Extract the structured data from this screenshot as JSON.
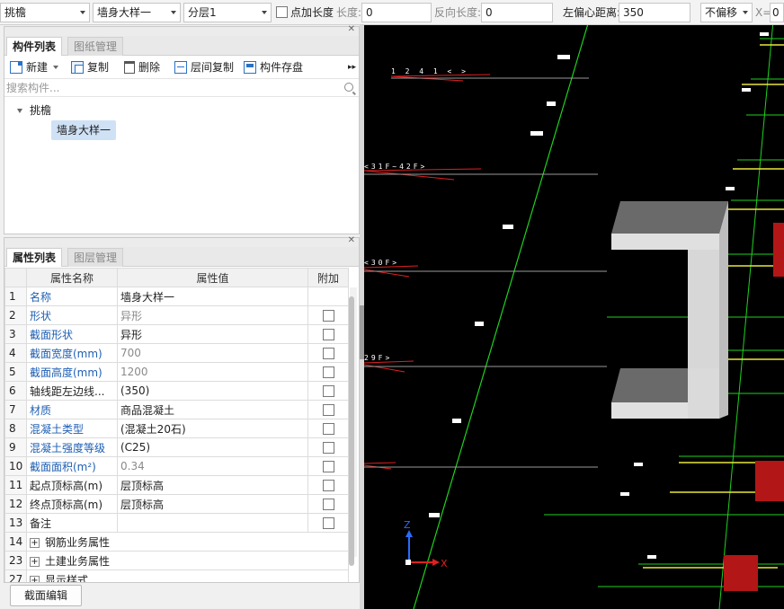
{
  "toolbar": {
    "category": "挑檐",
    "component": "墙身大样一",
    "layer": "分层1",
    "point_length_label": "点加长度",
    "length_label": "长度:",
    "length_value": "0",
    "reverse_length_label": "反向长度:",
    "reverse_length_value": "0",
    "left_offset_label": "左偏心距离:",
    "left_offset_value": "350",
    "offset_mode": "不偏移",
    "x_label": "X=",
    "x_value": "0"
  },
  "component_panel": {
    "tabs": [
      "构件列表",
      "图纸管理"
    ],
    "tools": {
      "new": "新建",
      "copy": "复制",
      "delete": "删除",
      "floor_copy": "层间复制",
      "save": "构件存盘"
    },
    "search_placeholder": "搜索构件...",
    "tree": {
      "root": "挑檐",
      "child": "墙身大样一"
    }
  },
  "property_panel": {
    "tabs": [
      "属性列表",
      "图层管理"
    ],
    "columns": [
      "",
      "属性名称",
      "属性值",
      "附加"
    ],
    "rows": [
      {
        "no": "1",
        "name": "名称",
        "value": "墙身大样一"
      },
      {
        "no": "2",
        "name": "形状",
        "value": "异形"
      },
      {
        "no": "3",
        "name": "截面形状",
        "value": "异形"
      },
      {
        "no": "4",
        "name": "截面宽度(mm)",
        "value": "700"
      },
      {
        "no": "5",
        "name": "截面高度(mm)",
        "value": "1200"
      },
      {
        "no": "6",
        "name": "轴线距左边线...",
        "value": "(350)"
      },
      {
        "no": "7",
        "name": "材质",
        "value": "商品混凝土"
      },
      {
        "no": "8",
        "name": "混凝土类型",
        "value": "(混凝土20石)"
      },
      {
        "no": "9",
        "name": "混凝土强度等级",
        "value": "(C25)"
      },
      {
        "no": "10",
        "name": "截面面积(m²)",
        "value": "0.34"
      },
      {
        "no": "11",
        "name": "起点顶标高(m)",
        "value": "层顶标高"
      },
      {
        "no": "12",
        "name": "终点顶标高(m)",
        "value": "层顶标高"
      },
      {
        "no": "13",
        "name": "备注",
        "value": ""
      },
      {
        "no": "14",
        "name": "钢筋业务属性",
        "value": ""
      },
      {
        "no": "23",
        "name": "土建业务属性",
        "value": ""
      },
      {
        "no": "27",
        "name": "显示样式",
        "value": ""
      }
    ],
    "section_edit_button": "截面编辑"
  },
  "viewport": {
    "axis_labels": {
      "z": "Z",
      "x": "X"
    },
    "colors": {
      "background": "#000000",
      "axis_line": "#1fd11f",
      "wall_body": "#e0e0e0",
      "wall_shade": "#bdbdbd",
      "wall_top": "#6a6a6a",
      "annotation": "#e02020"
    }
  }
}
